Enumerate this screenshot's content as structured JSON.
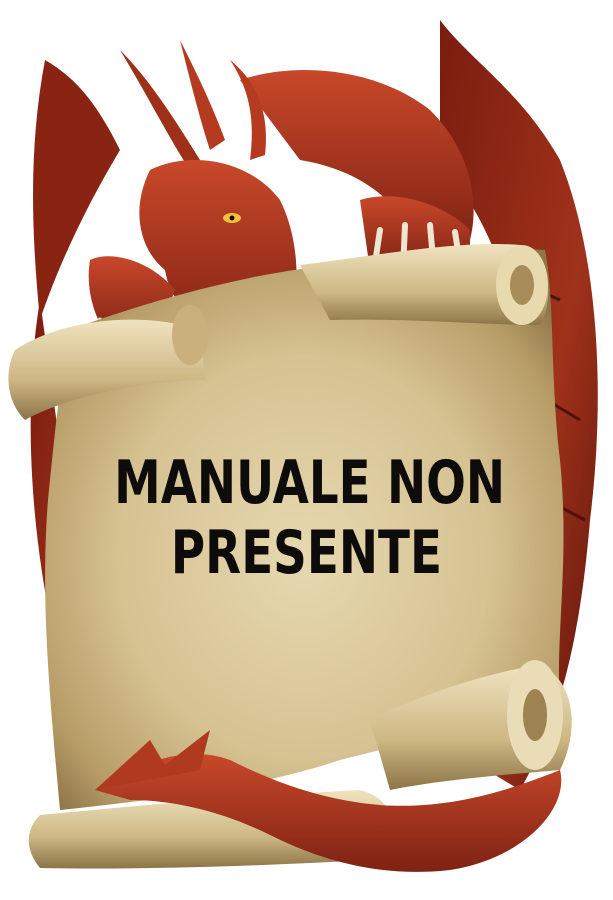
{
  "image": {
    "description_icon": "dragon-holding-scroll-illustration",
    "background_color": "#ffffff"
  },
  "message": {
    "line1": "MANUALE NON",
    "line2": "PRESENTE"
  },
  "colors": {
    "dragon_red": "#a83219",
    "dragon_dark": "#5e160c",
    "parchment": "#d8c79a",
    "parchment_shadow": "#8f7649",
    "text": "#0e0c0a"
  }
}
